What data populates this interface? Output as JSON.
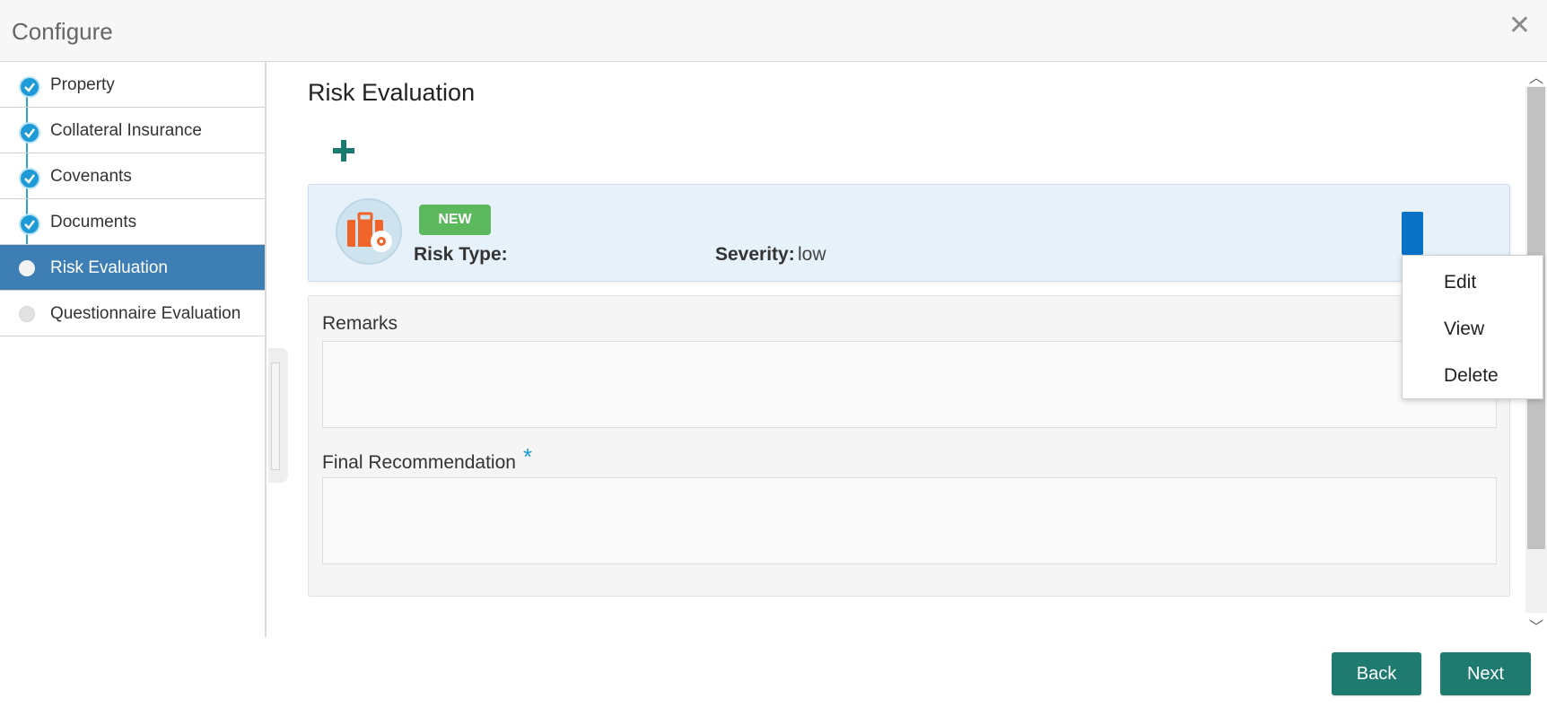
{
  "header": {
    "title": "Configure",
    "close_icon": "close-icon"
  },
  "sidebar": {
    "items": [
      {
        "label": "Property",
        "state": "completed"
      },
      {
        "label": "Collateral Insurance",
        "state": "completed"
      },
      {
        "label": "Covenants",
        "state": "completed"
      },
      {
        "label": "Documents",
        "state": "completed"
      },
      {
        "label": "Risk Evaluation",
        "state": "active"
      },
      {
        "label": "Questionnaire Evaluation",
        "state": "pending"
      }
    ]
  },
  "main": {
    "title": "Risk Evaluation",
    "add_icon": "plus-icon",
    "card": {
      "badge": "NEW",
      "risk_type_label": "Risk Type:",
      "risk_type_value": "",
      "severity_label": "Severity:",
      "severity_value": "low",
      "icon": "briefcase-gear-icon"
    },
    "remarks": {
      "label": "Remarks",
      "value": ""
    },
    "final_recommendation": {
      "label": "Final Recommendation",
      "required_mark": "*",
      "value": ""
    }
  },
  "menu": {
    "items": [
      "Edit",
      "View",
      "Delete"
    ]
  },
  "footer": {
    "back_label": "Back",
    "next_label": "Next"
  },
  "colors": {
    "accent": "#1f7a70",
    "active_nav": "#3d7fb5",
    "badge": "#5cb85c",
    "menu_trigger": "#0a73c8"
  }
}
